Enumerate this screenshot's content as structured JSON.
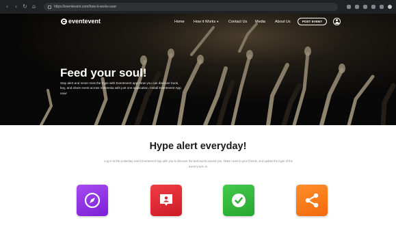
{
  "browser": {
    "url": "https://eventevent.com/how-it-works-user"
  },
  "nav": {
    "brand": "eventevent",
    "links": [
      "Home",
      "How it Works",
      "Contact Us",
      "Media",
      "About Us"
    ],
    "post_event_label": "POST EVENT"
  },
  "hero": {
    "title": "Feed your soul!",
    "text": "Stay alert and never miss the hype with Eventevent app! Now you can discover book, buy, and share event across Indonesia with just one application. Install Eventevent App now!"
  },
  "section": {
    "title": "Hype alert everyday!",
    "text": "Log in to the yesterday event Eventevent App able you to discover the best event around you, share news to your friends, and update the hype of the event you're in."
  },
  "features": [
    {
      "icon": "compass-icon",
      "color": "#8a2be2"
    },
    {
      "icon": "chat-user-icon",
      "color": "#e0242f"
    },
    {
      "icon": "check-circle-icon",
      "color": "#2fb539"
    },
    {
      "icon": "share-icon",
      "color": "#f97a16"
    }
  ]
}
